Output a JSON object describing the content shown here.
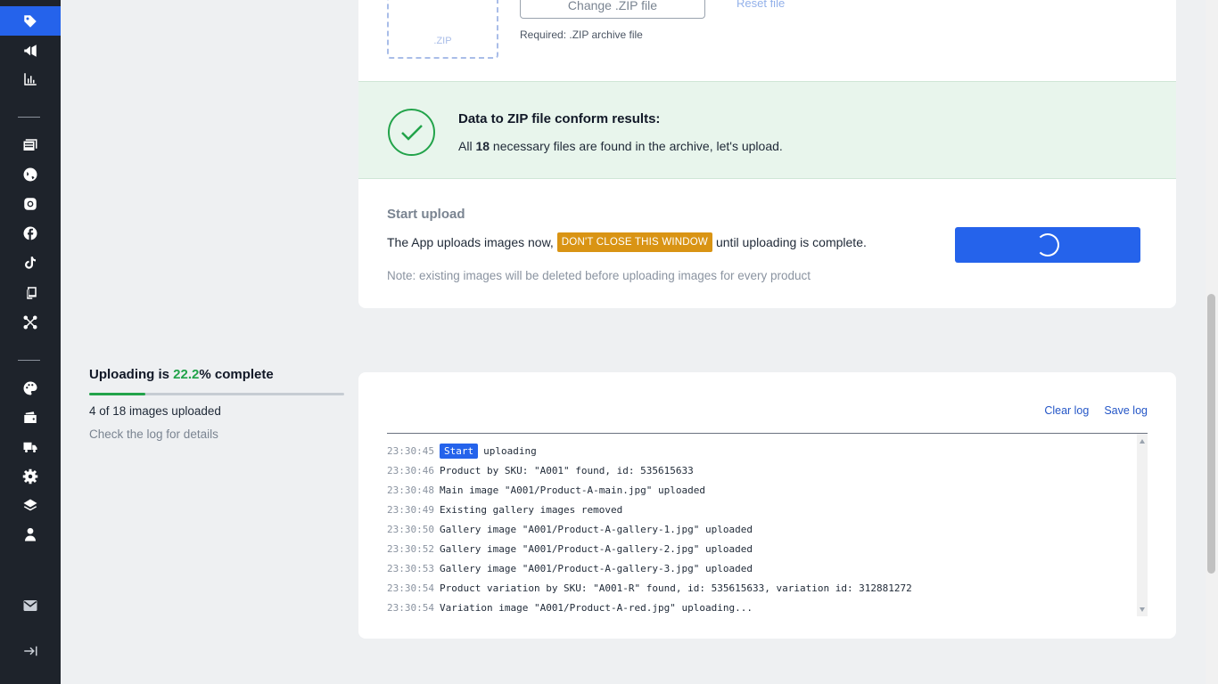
{
  "sidebar": {
    "items": [
      {
        "name": "tag-icon",
        "active": true
      },
      {
        "name": "megaphone-icon",
        "active": false
      },
      {
        "name": "chart-icon",
        "active": false
      },
      {
        "name": "catalog-icon",
        "active": false
      },
      {
        "name": "globe-icon",
        "active": false
      },
      {
        "name": "instagram-icon",
        "active": false
      },
      {
        "name": "facebook-icon",
        "active": false
      },
      {
        "name": "tiktok-icon",
        "active": false
      },
      {
        "name": "devices-icon",
        "active": false
      },
      {
        "name": "share-icon",
        "active": false
      },
      {
        "name": "palette-icon",
        "active": false
      },
      {
        "name": "wallet-icon",
        "active": false
      },
      {
        "name": "truck-icon",
        "active": false
      },
      {
        "name": "settings-icon",
        "active": false
      },
      {
        "name": "layers-icon",
        "active": false
      },
      {
        "name": "user-icon",
        "active": false
      },
      {
        "name": "mail-icon",
        "active": false
      },
      {
        "name": "expand-icon",
        "active": false
      }
    ]
  },
  "upload_area": {
    "zip_label": ".ZIP",
    "change_button": "Change .ZIP file",
    "reset_link": "Reset file",
    "required_note": "Required: .ZIP archive file"
  },
  "conform": {
    "title": "Data to ZIP file conform results:",
    "text_prefix": "All",
    "files_count": "18",
    "text_suffix": "necessary files are found in the archive, let's upload."
  },
  "start_upload": {
    "title": "Start upload",
    "text_before": "The App uploads images now,",
    "warning_badge": "DON'T CLOSE THIS WINDOW",
    "text_after": "until uploading is complete.",
    "note": "Note: existing images will be deleted before uploading images for every product"
  },
  "progress": {
    "title_prefix": "Uploading is",
    "percent": "22.2",
    "title_suffix": "% complete",
    "fraction": 0.222,
    "count_text": "4 of 18 images uploaded",
    "hint": "Check the log for details"
  },
  "log": {
    "clear_label": "Clear log",
    "save_label": "Save log",
    "lines": [
      {
        "time": "23:30:45",
        "tag": "Start",
        "text": "uploading"
      },
      {
        "time": "23:30:46",
        "tag": "",
        "text": "Product by SKU: \"A001\" found, id: 535615633"
      },
      {
        "time": "23:30:48",
        "tag": "",
        "text": "Main image \"A001/Product-A-main.jpg\" uploaded"
      },
      {
        "time": "23:30:49",
        "tag": "",
        "text": "Existing gallery images removed"
      },
      {
        "time": "23:30:50",
        "tag": "",
        "text": "Gallery image \"A001/Product-A-gallery-1.jpg\" uploaded"
      },
      {
        "time": "23:30:52",
        "tag": "",
        "text": "Gallery image \"A001/Product-A-gallery-2.jpg\" uploaded"
      },
      {
        "time": "23:30:53",
        "tag": "",
        "text": "Gallery image \"A001/Product-A-gallery-3.jpg\" uploaded"
      },
      {
        "time": "23:30:54",
        "tag": "",
        "text": "Product variation by SKU: \"A001-R\" found, id: 535615633, variation id: 312881272"
      },
      {
        "time": "23:30:54",
        "tag": "",
        "text": "Variation image \"A001/Product-A-red.jpg\" uploading..."
      }
    ]
  },
  "colors": {
    "accent": "#2563eb",
    "success": "#22a34a",
    "warning": "#d99414",
    "sidebar_bg": "#1e232b"
  }
}
